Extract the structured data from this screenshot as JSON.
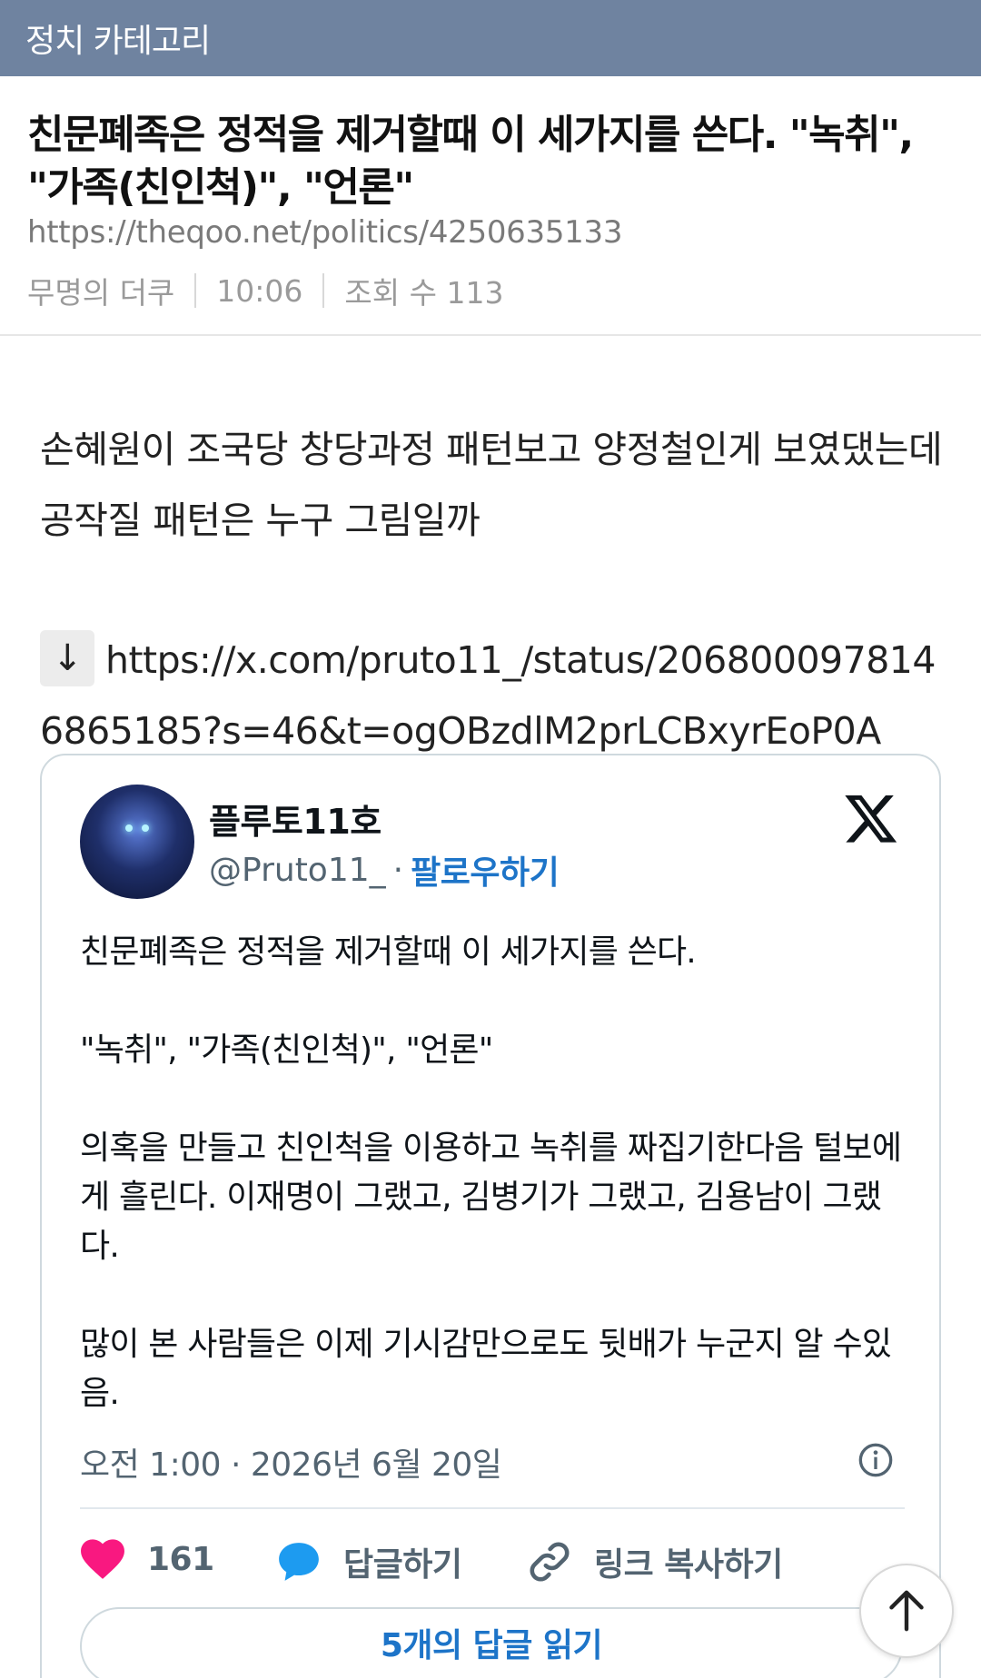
{
  "category_bar": {
    "label": "정치 카테고리",
    "color": "#6f83a0"
  },
  "post": {
    "title": "친문폐족은 정적을 제거할때 이 세가지를 쓴다. \"녹취\", \"가족(친인척)\", \"언론\"",
    "url": "https://theqoo.net/politics/4250635133",
    "author": "무명의 더쿠",
    "time": "10:06",
    "views": "조회 수 113",
    "body": "손혜원이 조국당 창당과정 패턴보고 양정철인게 보였댔는데 공작질 패턴은 누구 그림일까",
    "link_arrow": "↓",
    "link": "https://x.com/pruto11_/status/2068000978146865185?s=46&t=ogOBzdlM2prLCBxyrEoP0A"
  },
  "tweet": {
    "name": "플루토11호",
    "handle": "@Pruto11_",
    "dot": "·",
    "follow_label": "팔로우하기",
    "paragraphs": [
      "친문폐족은 정적을 제거할때 이 세가지를 쓴다.",
      "\"녹취\", \"가족(친인척)\", \"언론\"",
      "의혹을 만들고 친인척을 이용하고 녹취를 짜집기한다음 털보에게 흘린다. 이재명이 그랬고, 김병기가 그랬고, 김용남이 그랬다.",
      "많이 본 사람들은 이제 기시감만으로도 뒷배가 누군지 알 수있음."
    ],
    "timestamp": "오전 1:00 · 2026년 6월 20일",
    "likes": "161",
    "reply_label": "답글하기",
    "copy_link_label": "링크 복사하기",
    "read_replies_label": "5개의 답글 읽기",
    "icons": [
      "x-logo-icon",
      "info-icon",
      "heart-icon",
      "reply-bubble-icon",
      "link-icon"
    ],
    "colors": {
      "like": "#f91880",
      "reply": "#1d9bf0",
      "follow": "#1d74c8"
    }
  },
  "scroll_top_icon": "arrow-up-icon"
}
